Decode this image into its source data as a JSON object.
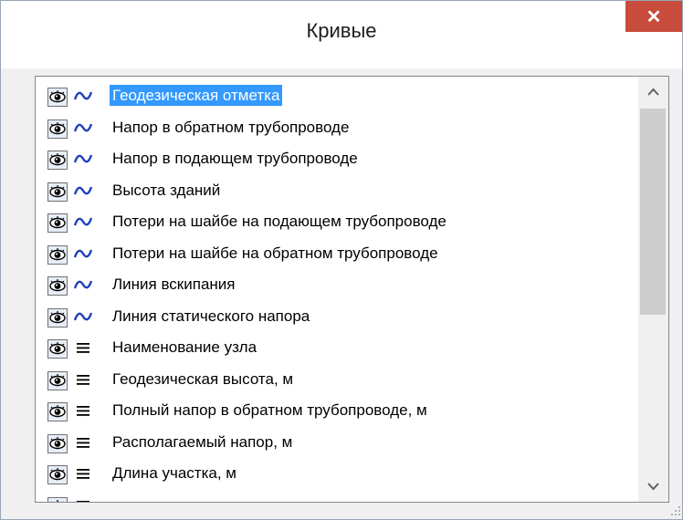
{
  "window": {
    "title": "Кривые",
    "close_label": "✕"
  },
  "list": {
    "items": [
      {
        "label": "Геодезическая отметка",
        "type": "curve",
        "selected": true
      },
      {
        "label": "Напор в обратном трубопроводе",
        "type": "curve"
      },
      {
        "label": "Напор в подающем трубопроводе",
        "type": "curve"
      },
      {
        "label": "Высота зданий",
        "type": "curve"
      },
      {
        "label": "Потери на шайбе на подающем трубопроводе",
        "type": "curve"
      },
      {
        "label": "Потери на шайбе на обратном трубопроводе",
        "type": "curve"
      },
      {
        "label": "Линия вскипания",
        "type": "curve"
      },
      {
        "label": "Линия статического напора",
        "type": "curve"
      },
      {
        "label": "Наименование узла",
        "type": "table"
      },
      {
        "label": "Геодезическая высота, м",
        "type": "table"
      },
      {
        "label": "Полный напор в обратном трубопроводе, м",
        "type": "table"
      },
      {
        "label": "Располагаемый напор, м",
        "type": "table"
      },
      {
        "label": "Длина участка, м",
        "type": "table"
      },
      {
        "label": "",
        "type": "table"
      }
    ]
  },
  "icons": {
    "visibility": "eye-icon",
    "curve": "curve-icon",
    "table": "table-icon",
    "scroll_up": "chevron-up-icon",
    "scroll_down": "chevron-down-icon"
  },
  "colors": {
    "selection": "#3399ff",
    "close_button": "#c74c3c",
    "curve_icon": "#1f3fbf"
  }
}
